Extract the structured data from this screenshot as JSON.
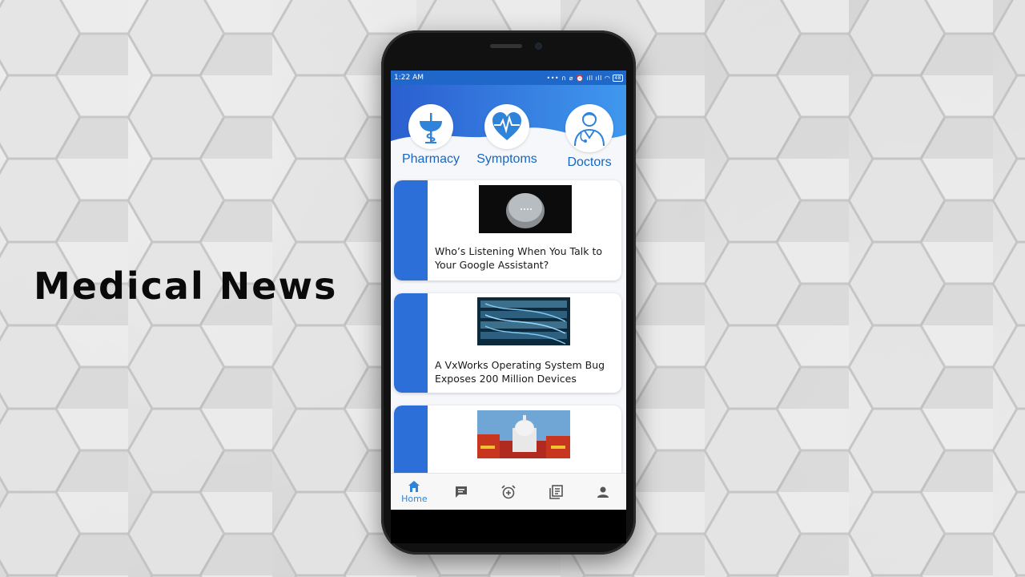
{
  "headline": "Medical News",
  "status_bar": {
    "time": "1:22 AM",
    "indicators": "••• ∩ ⌀ ⏰ ıll ıll ◠",
    "battery": "48"
  },
  "categories": [
    {
      "label": "Pharmacy",
      "icon": "pharmacy-bowl-icon"
    },
    {
      "label": "Symptoms",
      "icon": "heart-pulse-icon"
    },
    {
      "label": "Doctors",
      "icon": "doctor-icon"
    }
  ],
  "articles": [
    {
      "title": "Who’s Listening When You Talk to Your Google Assistant?",
      "image": "smart-speaker-image"
    },
    {
      "title": "A VxWorks Operating System Bug Exposes 200 Million Devices",
      "image": "server-rack-image"
    },
    {
      "title": "",
      "image": "capitol-building-image"
    }
  ],
  "bottom_nav": {
    "home_label": "Home",
    "items": [
      "home-icon",
      "chat-icon",
      "alarm-icon",
      "library-icon",
      "profile-icon"
    ]
  },
  "colors": {
    "primary": "#2c6fd8",
    "status_bar": "#1f68c9",
    "label": "#1666c4",
    "active_nav": "#2f83d9"
  }
}
